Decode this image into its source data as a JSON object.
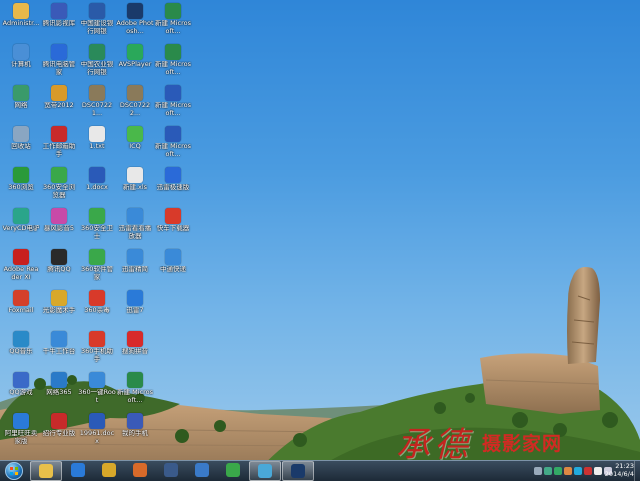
{
  "desktop": {
    "icons": [
      {
        "label": "Administr...",
        "icon": "user-folder-icon",
        "color": "#e8b84a",
        "col": 0,
        "row": 0
      },
      {
        "label": "计算机",
        "icon": "computer-icon",
        "color": "#4a8fd6",
        "col": 0,
        "row": 1
      },
      {
        "label": "网络",
        "icon": "network-icon",
        "color": "#3a9a6a",
        "col": 0,
        "row": 2
      },
      {
        "label": "回收站",
        "icon": "recycle-bin-icon",
        "color": "#8aa6c2",
        "col": 0,
        "row": 3
      },
      {
        "label": "360浏览",
        "icon": "browser-icon",
        "color": "#2a9a3a",
        "col": 0,
        "row": 4
      },
      {
        "label": "VeryCD电驴",
        "icon": "app-icon",
        "color": "#2aa58a",
        "col": 0,
        "row": 5
      },
      {
        "label": "Adobe Reader XI",
        "icon": "pdf-icon",
        "color": "#c8201e",
        "col": 0,
        "row": 6
      },
      {
        "label": "Foxmail",
        "icon": "mail-icon",
        "color": "#d4402a",
        "col": 0,
        "row": 7
      },
      {
        "label": "QQ音乐",
        "icon": "music-icon",
        "color": "#2a8ac8",
        "col": 0,
        "row": 8
      },
      {
        "label": "QQ游戏",
        "icon": "game-icon",
        "color": "#3a6ac8",
        "col": 0,
        "row": 9
      },
      {
        "label": "阿里旺旺卖家版",
        "icon": "chat-icon",
        "color": "#2a7ad8",
        "col": 0,
        "row": 10
      },
      {
        "label": "腾讯影视库",
        "icon": "video-icon",
        "color": "#3a5ab8",
        "col": 1,
        "row": 0
      },
      {
        "label": "腾讯电脑管家",
        "icon": "shield-icon",
        "color": "#2a6ad8",
        "col": 1,
        "row": 1
      },
      {
        "label": "宽带2012",
        "icon": "app-icon",
        "color": "#d89a2a",
        "col": 1,
        "row": 2
      },
      {
        "label": "工作邮箱助手",
        "icon": "mail-icon",
        "color": "#c82a2a",
        "col": 1,
        "row": 3
      },
      {
        "label": "360安全浏览器",
        "icon": "browser-icon",
        "color": "#3aa84a",
        "col": 1,
        "row": 4
      },
      {
        "label": "暴风影音5",
        "icon": "video-icon",
        "color": "#c84aa8",
        "col": 1,
        "row": 5
      },
      {
        "label": "腾讯QQ",
        "icon": "qq-icon",
        "color": "#2a2a2a",
        "col": 1,
        "row": 6
      },
      {
        "label": "光影魔术手",
        "icon": "photo-icon",
        "color": "#d8a82a",
        "col": 1,
        "row": 7
      },
      {
        "label": "千牛工作台",
        "icon": "app-icon",
        "color": "#3a8ad8",
        "col": 1,
        "row": 8
      },
      {
        "label": "网络365",
        "icon": "app-icon",
        "color": "#2a7ac8",
        "col": 1,
        "row": 9
      },
      {
        "label": "招行专业版",
        "icon": "bank-icon",
        "color": "#c82a2a",
        "col": 1,
        "row": 10
      },
      {
        "label": "中国建设银行网银",
        "icon": "bank-icon",
        "color": "#2a5aa8",
        "col": 2,
        "row": 0
      },
      {
        "label": "中国农业银行网银",
        "icon": "bank-icon",
        "color": "#2a8a5a",
        "col": 2,
        "row": 1
      },
      {
        "label": "DSC07221...",
        "icon": "image-file-icon",
        "color": "#8a7a5a",
        "col": 2,
        "row": 2
      },
      {
        "label": "1.txt",
        "icon": "text-file-icon",
        "color": "#e8e8e8",
        "col": 2,
        "row": 3
      },
      {
        "label": "1.docx",
        "icon": "word-file-icon",
        "color": "#2a5ab8",
        "col": 2,
        "row": 4
      },
      {
        "label": "360安全卫士",
        "icon": "shield-icon",
        "color": "#3aa84a",
        "col": 2,
        "row": 5
      },
      {
        "label": "360软件管家",
        "icon": "app-icon",
        "color": "#3aa84a",
        "col": 2,
        "row": 6
      },
      {
        "label": "360杀毒",
        "icon": "shield-icon",
        "color": "#d83a2a",
        "col": 2,
        "row": 7
      },
      {
        "label": "360手机助手",
        "icon": "phone-icon",
        "color": "#d83a2a",
        "col": 2,
        "row": 8
      },
      {
        "label": "360一键Root",
        "icon": "app-icon",
        "color": "#3a8ad8",
        "col": 2,
        "row": 9
      },
      {
        "label": "19961.docx",
        "icon": "word-file-icon",
        "color": "#2a5ab8",
        "col": 2,
        "row": 10
      },
      {
        "label": "Adobe Photosh...",
        "icon": "photoshop-icon",
        "color": "#1a3a6a",
        "col": 3,
        "row": 0
      },
      {
        "label": "AVSPlayer",
        "icon": "player-icon",
        "color": "#2aa85a",
        "col": 3,
        "row": 1
      },
      {
        "label": "DSC07222...",
        "icon": "image-file-icon",
        "color": "#8a7a5a",
        "col": 3,
        "row": 2
      },
      {
        "label": "ICQ",
        "icon": "chat-icon",
        "color": "#4ab84a",
        "col": 3,
        "row": 3
      },
      {
        "label": "新建.xls",
        "icon": "text-file-icon",
        "color": "#e8e8e8",
        "col": 3,
        "row": 4
      },
      {
        "label": "迅雷看看播放器",
        "icon": "player-icon",
        "color": "#3a8ad8",
        "col": 3,
        "row": 5
      },
      {
        "label": "迅雷精简",
        "icon": "download-icon",
        "color": "#3a8ad8",
        "col": 3,
        "row": 6
      },
      {
        "label": "迅雷7",
        "icon": "download-icon",
        "color": "#2a7ad8",
        "col": 3,
        "row": 7
      },
      {
        "label": "搜狗拼音",
        "icon": "app-icon",
        "color": "#d82a2a",
        "col": 3,
        "row": 8
      },
      {
        "label": "新建 Microsoft...",
        "icon": "excel-file-icon",
        "color": "#2a8a4a",
        "col": 3,
        "row": 9
      },
      {
        "label": "我的手机",
        "icon": "phone-icon",
        "color": "#3a5ab8",
        "col": 3,
        "row": 10
      },
      {
        "label": "新建 Microsoft...",
        "icon": "excel-file-icon",
        "color": "#2a8a4a",
        "col": 4,
        "row": 0
      },
      {
        "label": "新建 Microsoft...",
        "icon": "excel-file-icon",
        "color": "#2a8a4a",
        "col": 4,
        "row": 1
      },
      {
        "label": "新建 Microsoft...",
        "icon": "word-file-icon",
        "color": "#2a5ab8",
        "col": 4,
        "row": 2
      },
      {
        "label": "新建 Microsoft...",
        "icon": "word-file-icon",
        "color": "#2a5ab8",
        "col": 4,
        "row": 3
      },
      {
        "label": "迅雷极速版",
        "icon": "download-icon",
        "color": "#2a6ad8",
        "col": 4,
        "row": 4
      },
      {
        "label": "快车下载器",
        "icon": "download-icon",
        "color": "#d83a2a",
        "col": 4,
        "row": 5
      },
      {
        "label": "中通快递",
        "icon": "app-icon",
        "color": "#3a8ad8",
        "col": 4,
        "row": 6
      }
    ]
  },
  "watermark": {
    "calligraphy": "承德",
    "site": "摄影家网"
  },
  "taskbar": {
    "pinned": [
      {
        "icon": "folder-icon",
        "color": "#e8c04a",
        "name": "explorer-taskbar-button",
        "active": true
      },
      {
        "icon": "ie-icon",
        "color": "#2a7ad8",
        "name": "ie-taskbar-button",
        "active": false
      },
      {
        "icon": "browser-icon",
        "color": "#d8a82a",
        "name": "browser-taskbar-button",
        "active": false
      },
      {
        "icon": "app-icon",
        "color": "#d86a2a",
        "name": "app-taskbar-button",
        "active": false
      },
      {
        "icon": "film-icon",
        "color": "#3a5a8a",
        "name": "media-taskbar-button",
        "active": false
      },
      {
        "icon": "window-icon",
        "color": "#3a7ac8",
        "name": "window-taskbar-button",
        "active": false
      },
      {
        "icon": "360-icon",
        "color": "#3aa84a",
        "name": "360-taskbar-button",
        "active": false
      },
      {
        "icon": "image-viewer-icon",
        "color": "#4aa8d8",
        "name": "viewer-taskbar-button",
        "active": true
      },
      {
        "icon": "photoshop-icon",
        "color": "#1a3a6a",
        "name": "photoshop-taskbar-button",
        "active": true
      }
    ],
    "clock_time": "21:23",
    "clock_date": "2014/6/4"
  }
}
